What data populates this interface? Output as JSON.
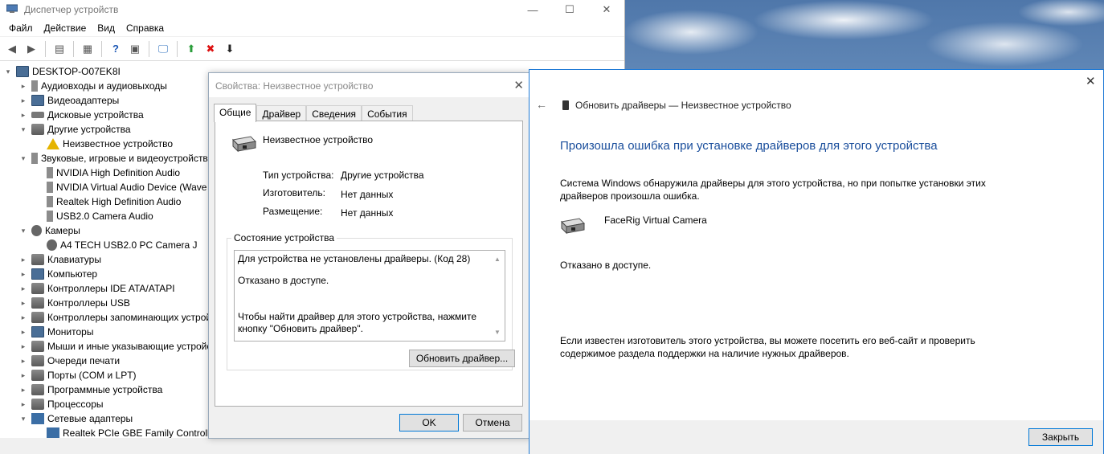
{
  "device_manager": {
    "title": "Диспетчер устройств",
    "window_controls": {
      "minimize": "—",
      "maximize": "☐",
      "close": "✕"
    },
    "menu": [
      "Файл",
      "Действие",
      "Вид",
      "Справка"
    ],
    "toolbar": [
      {
        "icon": "back-icon",
        "glyph": "◀"
      },
      {
        "icon": "forward-icon",
        "glyph": "▶"
      },
      {
        "icon": "properties-icon",
        "glyph": "▤"
      },
      {
        "icon": "list-icon",
        "glyph": "▦"
      },
      {
        "icon": "help-icon",
        "glyph": "?"
      },
      {
        "icon": "view-icon",
        "glyph": "▣"
      },
      {
        "icon": "monitor-icon",
        "glyph": "🖵"
      },
      {
        "icon": "add-driver-icon",
        "glyph": "⬆"
      },
      {
        "icon": "delete-icon",
        "glyph": "✖"
      },
      {
        "icon": "update-icon",
        "glyph": "⬇"
      }
    ],
    "tree": [
      {
        "label": "DESKTOP-O07EK8I",
        "level": 0,
        "expanded": "open",
        "icon": "computer-icon"
      },
      {
        "label": "Аудиовходы и аудиовыходы",
        "level": 1,
        "expanded": "closed",
        "icon": "speaker-icon"
      },
      {
        "label": "Видеоадаптеры",
        "level": 1,
        "expanded": "closed",
        "icon": "monitor-icon"
      },
      {
        "label": "Дисковые устройства",
        "level": 1,
        "expanded": "closed",
        "icon": "disk-icon"
      },
      {
        "label": "Другие устройства",
        "level": 1,
        "expanded": "open",
        "icon": "device-icon"
      },
      {
        "label": "Неизвестное устройство",
        "level": 2,
        "expanded": "none",
        "icon": "warning-icon"
      },
      {
        "label": "Звуковые, игровые и видеоустройства",
        "level": 1,
        "expanded": "open",
        "icon": "speaker-icon"
      },
      {
        "label": "NVIDIA High Definition Audio",
        "level": 2,
        "expanded": "none",
        "icon": "speaker-icon"
      },
      {
        "label": "NVIDIA Virtual Audio Device (Wave Extensible) (WDM)",
        "level": 2,
        "expanded": "none",
        "icon": "speaker-icon"
      },
      {
        "label": "Realtek High Definition Audio",
        "level": 2,
        "expanded": "none",
        "icon": "speaker-icon"
      },
      {
        "label": "USB2.0 Camera Audio",
        "level": 2,
        "expanded": "none",
        "icon": "speaker-icon"
      },
      {
        "label": "Камеры",
        "level": 1,
        "expanded": "open",
        "icon": "camera-icon"
      },
      {
        "label": "A4 TECH USB2.0 PC Camera J",
        "level": 2,
        "expanded": "none",
        "icon": "camera-icon"
      },
      {
        "label": "Клавиатуры",
        "level": 1,
        "expanded": "closed",
        "icon": "keyboard-icon"
      },
      {
        "label": "Компьютер",
        "level": 1,
        "expanded": "closed",
        "icon": "computer-icon"
      },
      {
        "label": "Контроллеры IDE ATA/ATAPI",
        "level": 1,
        "expanded": "closed",
        "icon": "controller-icon"
      },
      {
        "label": "Контроллеры USB",
        "level": 1,
        "expanded": "closed",
        "icon": "usb-icon"
      },
      {
        "label": "Контроллеры запоминающих устройств",
        "level": 1,
        "expanded": "closed",
        "icon": "storage-icon"
      },
      {
        "label": "Мониторы",
        "level": 1,
        "expanded": "closed",
        "icon": "monitor-icon"
      },
      {
        "label": "Мыши и иные указывающие устройства",
        "level": 1,
        "expanded": "closed",
        "icon": "mouse-icon"
      },
      {
        "label": "Очереди печати",
        "level": 1,
        "expanded": "closed",
        "icon": "printer-icon"
      },
      {
        "label": "Порты (COM и LPT)",
        "level": 1,
        "expanded": "closed",
        "icon": "port-icon"
      },
      {
        "label": "Программные устройства",
        "level": 1,
        "expanded": "closed",
        "icon": "device-icon"
      },
      {
        "label": "Процессоры",
        "level": 1,
        "expanded": "closed",
        "icon": "cpu-icon"
      },
      {
        "label": "Сетевые адаптеры",
        "level": 1,
        "expanded": "open",
        "icon": "network-icon"
      },
      {
        "label": "Realtek PCIe GBE Family Controller",
        "level": 2,
        "expanded": "none",
        "icon": "network-icon"
      }
    ]
  },
  "properties": {
    "title": "Свойства: Неизвестное устройство",
    "close_glyph": "✕",
    "tabs": [
      "Общие",
      "Драйвер",
      "Сведения",
      "События"
    ],
    "active_tab": "Общие",
    "device_name": "Неизвестное устройство",
    "fields": [
      {
        "label": "Тип устройства:",
        "value": "Другие устройства"
      },
      {
        "label": "Изготовитель:",
        "value": "Нет данных"
      },
      {
        "label": "Размещение:",
        "value": "Нет данных"
      }
    ],
    "status_title": "Состояние устройства",
    "status_lines": [
      "Для устройства не установлены драйверы. (Код 28)",
      "",
      "Отказано в доступе.",
      "",
      "",
      "Чтобы найти драйвер для этого устройства, нажмите кнопку \"Обновить драйвер\"."
    ],
    "update_driver_button": "Обновить драйвер...",
    "ok_button": "OK",
    "cancel_button": "Отмена"
  },
  "wizard": {
    "close_glyph": "✕",
    "back_glyph": "←",
    "title": "Обновить драйверы — Неизвестное устройство",
    "heading": "Произошла ошибка при установке драйверов для этого устройства",
    "text1": "Система Windows обнаружила драйверы для этого устройства, но при попытке установки этих драйверов произошла ошибка.",
    "device_name": "FaceRig Virtual Camera",
    "denied": "Отказано в доступе.",
    "text2": "Если известен изготовитель этого устройства, вы можете посетить его веб-сайт и проверить содержимое раздела поддержки на наличие нужных драйверов.",
    "close_button": "Закрыть"
  }
}
